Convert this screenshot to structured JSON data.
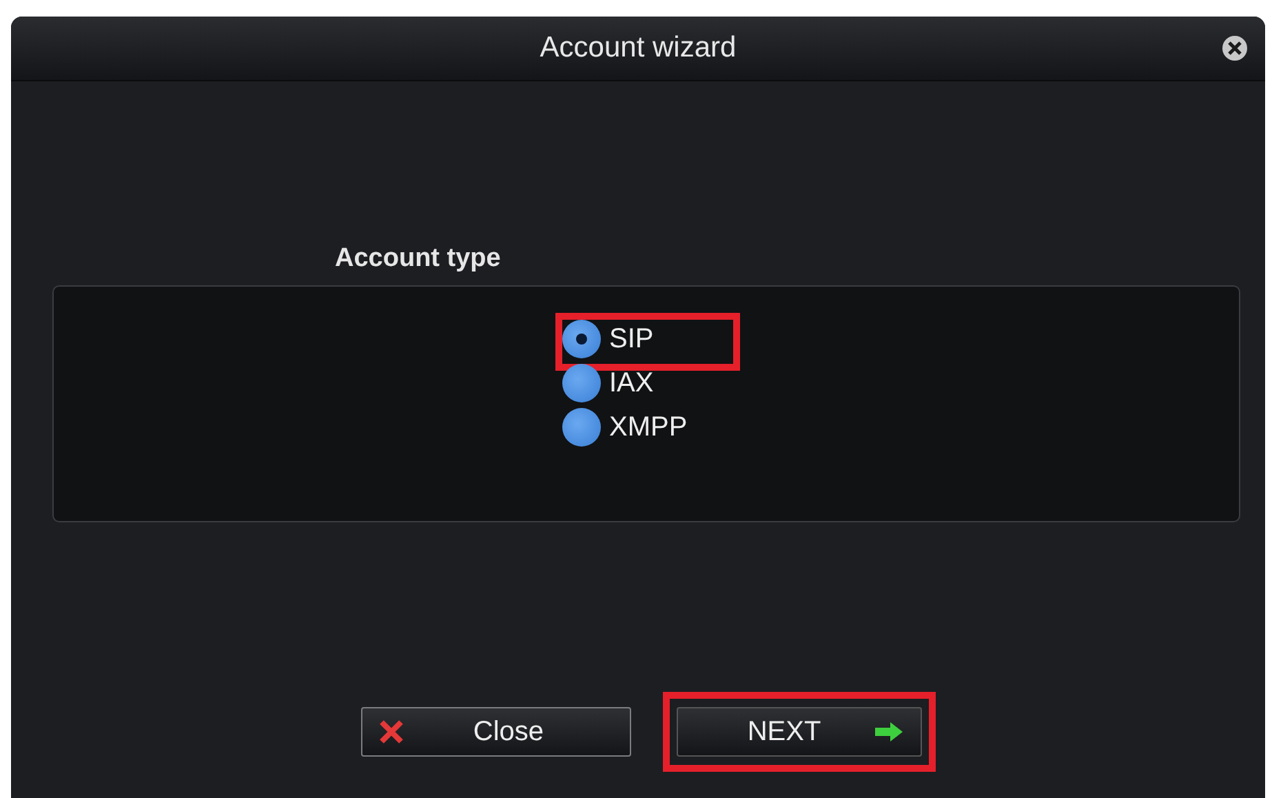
{
  "window": {
    "title": "Account wizard"
  },
  "account_type": {
    "label": "Account type",
    "options": [
      {
        "label": "SIP",
        "selected": true,
        "highlighted": true
      },
      {
        "label": "IAX",
        "selected": false,
        "highlighted": false
      },
      {
        "label": "XMPP",
        "selected": false,
        "highlighted": false
      }
    ]
  },
  "buttons": [
    {
      "kind": "close",
      "label": "Close",
      "highlighted": false
    },
    {
      "kind": "next",
      "label": "NEXT",
      "highlighted": true
    }
  ]
}
